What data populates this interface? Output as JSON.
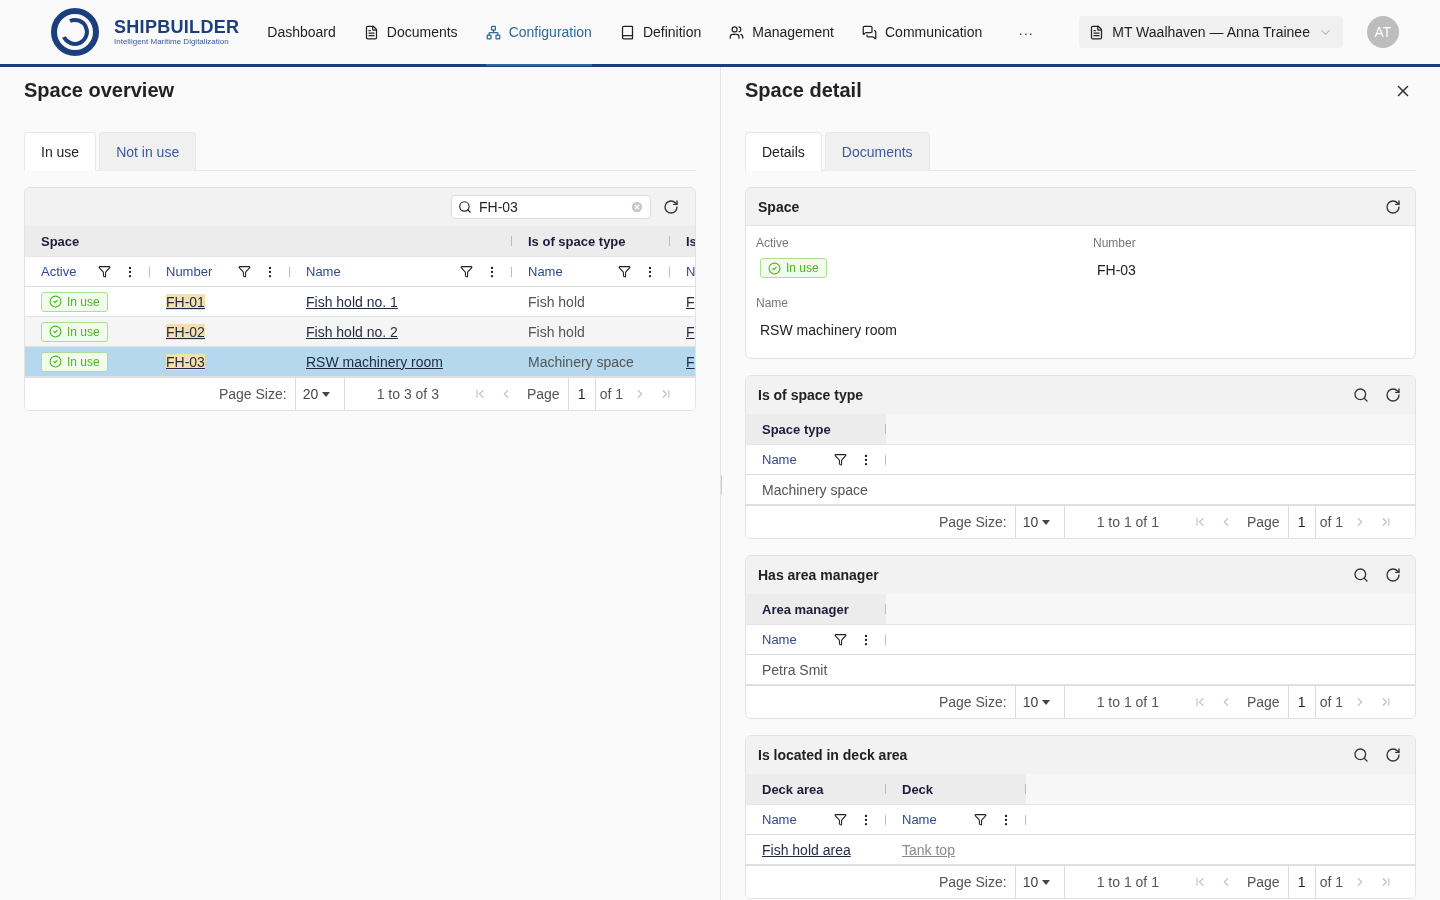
{
  "header": {
    "logo": {
      "name": "SHIPBUILDER",
      "tagline": "Intelligent Maritime Digitalization"
    },
    "nav": [
      {
        "label": "Dashboard",
        "selected": false
      },
      {
        "label": "Documents",
        "selected": false
      },
      {
        "label": "Configuration",
        "selected": true
      },
      {
        "label": "Definition",
        "selected": false
      },
      {
        "label": "Management",
        "selected": false
      },
      {
        "label": "Communication",
        "selected": false
      }
    ],
    "more": "···",
    "context": "MT Waalhaven — Anna Trainee",
    "avatar": "AT"
  },
  "overview": {
    "title": "Space overview",
    "tabs": [
      {
        "label": "In use",
        "selected": true
      },
      {
        "label": "Not in use",
        "selected": false
      }
    ],
    "search": {
      "value": "FH-03"
    },
    "groups": [
      {
        "label": "Space",
        "columns": [
          {
            "label": "Active",
            "kind": "full"
          },
          {
            "label": "Number",
            "kind": "full"
          },
          {
            "label": "Name",
            "kind": "full"
          }
        ]
      },
      {
        "label": "Is of space type",
        "columns": [
          {
            "label": "Name",
            "kind": "full"
          }
        ]
      },
      {
        "label": "Is",
        "columns": [
          {
            "label": "N",
            "kind": "cut"
          }
        ]
      }
    ],
    "rows": [
      {
        "selected": false,
        "cells": [
          {
            "kind": "badge",
            "text": "In use"
          },
          {
            "kind": "match_link",
            "text": "FH-01"
          },
          {
            "kind": "link",
            "text": "Fish hold no. 1"
          },
          {
            "kind": "text",
            "text": "Fish hold"
          },
          {
            "kind": "link",
            "text": "F"
          }
        ]
      },
      {
        "selected": false,
        "cells": [
          {
            "kind": "badge",
            "text": "In use"
          },
          {
            "kind": "match_link",
            "text": "FH-02"
          },
          {
            "kind": "link",
            "text": "Fish hold no. 2"
          },
          {
            "kind": "text",
            "text": "Fish hold"
          },
          {
            "kind": "link",
            "text": "F"
          }
        ]
      },
      {
        "selected": true,
        "cells": [
          {
            "kind": "badge",
            "text": "In use"
          },
          {
            "kind": "match_link",
            "text": "FH-03"
          },
          {
            "kind": "link",
            "text": "RSW machinery room"
          },
          {
            "kind": "text",
            "text": "Machinery space"
          },
          {
            "kind": "link",
            "text": "F"
          }
        ]
      }
    ],
    "pagination": {
      "size_label": "Page Size:",
      "size": "20",
      "range": "1 to 3 of 3",
      "page_label": "Page",
      "page": "1",
      "of": "of 1"
    }
  },
  "detail": {
    "title": "Space detail",
    "tabs": [
      {
        "label": "Details",
        "selected": true
      },
      {
        "label": "Documents",
        "selected": false
      }
    ],
    "space": {
      "title": "Space",
      "fields": [
        {
          "label": "Active",
          "kind": "badge",
          "value": "In use"
        },
        {
          "label": "Number",
          "kind": "text",
          "value": "FH-03"
        },
        {
          "label": "Name",
          "kind": "text",
          "value": "RSW machinery room"
        }
      ]
    },
    "relations": [
      {
        "title": "Is of space type",
        "groups": [
          {
            "label": "Space type",
            "columns": [
              {
                "label": "Name",
                "kind": "full"
              }
            ]
          }
        ],
        "rows": [
          {
            "selected": false,
            "cells": [
              {
                "kind": "text",
                "text": "Machinery space"
              }
            ]
          }
        ],
        "pagination": {
          "size_label": "Page Size:",
          "size": "10",
          "range": "1 to 1 of 1",
          "page_label": "Page",
          "page": "1",
          "of": "of 1"
        }
      },
      {
        "title": "Has area manager",
        "groups": [
          {
            "label": "Area manager",
            "columns": [
              {
                "label": "Name",
                "kind": "full"
              }
            ]
          }
        ],
        "rows": [
          {
            "selected": false,
            "cells": [
              {
                "kind": "text",
                "text": "Petra Smit"
              }
            ]
          }
        ],
        "pagination": {
          "size_label": "Page Size:",
          "size": "10",
          "range": "1 to 1 of 1",
          "page_label": "Page",
          "page": "1",
          "of": "of 1"
        }
      },
      {
        "title": "Is located in deck area",
        "groups": [
          {
            "label": "Deck area",
            "columns": [
              {
                "label": "Name",
                "kind": "full"
              }
            ]
          },
          {
            "label": "Deck",
            "columns": [
              {
                "label": "Name",
                "kind": "full"
              }
            ]
          }
        ],
        "rows": [
          {
            "selected": false,
            "cells": [
              {
                "kind": "link",
                "text": "Fish hold area"
              },
              {
                "kind": "muted_link",
                "text": "Tank top"
              }
            ]
          }
        ],
        "pagination": {
          "size_label": "Page Size:",
          "size": "10",
          "range": "1 to 1 of 1",
          "page_label": "Page",
          "page": "1",
          "of": "of 1"
        }
      }
    ]
  }
}
